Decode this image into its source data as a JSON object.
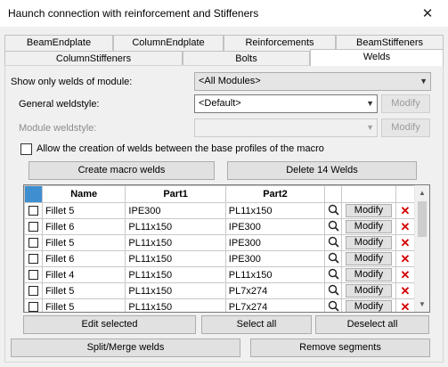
{
  "window": {
    "title": "Haunch connection with reinforcement and Stiffeners",
    "close_glyph": "✕"
  },
  "tabs_row1": [
    {
      "label": "BeamEndplate"
    },
    {
      "label": "ColumnEndplate"
    },
    {
      "label": "Reinforcements"
    },
    {
      "label": "BeamStiffeners"
    }
  ],
  "tabs_row2": [
    {
      "label": "ColumnStiffeners"
    },
    {
      "label": "Bolts"
    },
    {
      "label": "Welds"
    }
  ],
  "filter": {
    "label": "Show only welds of module:",
    "value": "<All Modules>"
  },
  "general_weldstyle": {
    "label": "General weldstyle:",
    "value": "<Default>",
    "modify_label": "Modify"
  },
  "module_weldstyle": {
    "label": "Module weldstyle:",
    "value": "",
    "modify_label": "Modify"
  },
  "allow_checkbox": {
    "label": "Allow the creation of welds between the base profiles of the macro"
  },
  "actions": {
    "create": "Create macro welds",
    "delete": "Delete 14 Welds"
  },
  "table": {
    "columns": [
      "",
      "Name",
      "Part1",
      "Part2",
      "",
      "",
      ""
    ],
    "modify_label": "Modify",
    "rows": [
      {
        "name": "Fillet 5",
        "part1": "IPE300",
        "part2": "PL11x150"
      },
      {
        "name": "Fillet 6",
        "part1": "PL11x150",
        "part2": "IPE300"
      },
      {
        "name": "Fillet 5",
        "part1": "PL11x150",
        "part2": "IPE300"
      },
      {
        "name": "Fillet 6",
        "part1": "PL11x150",
        "part2": "IPE300"
      },
      {
        "name": "Fillet 4",
        "part1": "PL11x150",
        "part2": "PL11x150"
      },
      {
        "name": "Fillet 5",
        "part1": "PL11x150",
        "part2": "PL7x274"
      },
      {
        "name": "Fillet 5",
        "part1": "PL11x150",
        "part2": "PL7x274"
      }
    ]
  },
  "bottom": {
    "edit_selected": "Edit selected",
    "select_all": "Select all",
    "deselect_all": "Deselect all",
    "split_merge": "Split/Merge welds",
    "remove_segments": "Remove segments"
  },
  "colors": {
    "header_selected": "#3f8fd0",
    "delete_icon": "#d40000"
  }
}
